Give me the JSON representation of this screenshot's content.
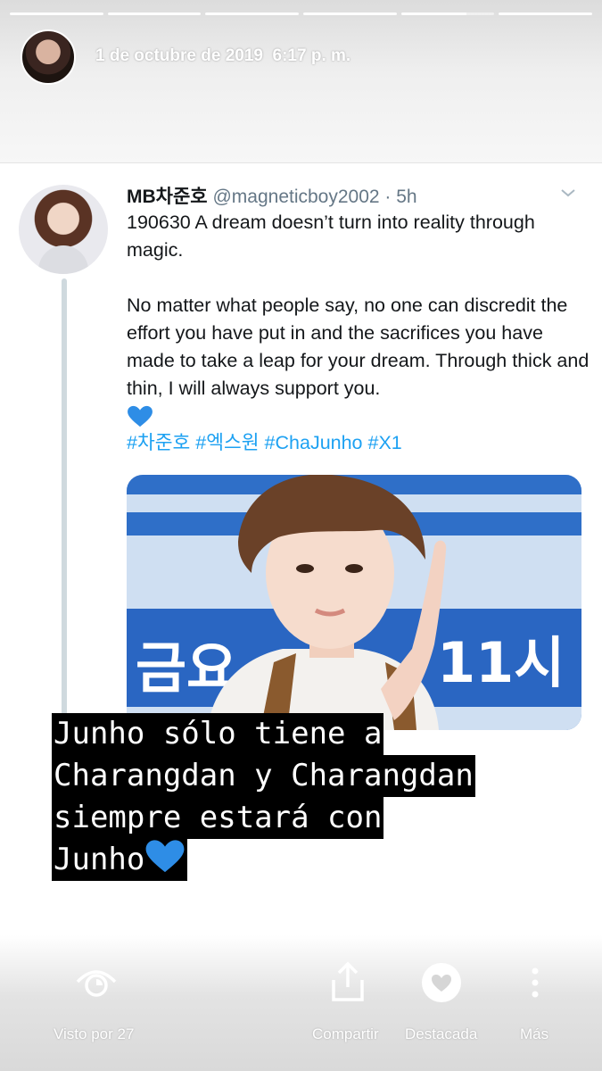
{
  "story": {
    "progress_segments": 6,
    "current_segment": 5,
    "date": "1 de octubre de 2019",
    "time": "6:17 p. m."
  },
  "tweet": {
    "display_name": "MB차준호",
    "handle": "@magneticboy2002",
    "time_ago": "· 5h",
    "paragraph1": "190630 A dream doesn’t turn into reality through magic.",
    "paragraph2": "No matter what people say, no one can discredit the effort you have put in and the sacrifices you have made to take a leap for your dream. Through thick and thin, I will always support you.",
    "hashtags": "#차준호 #엑스원 #ChaJunho #X1",
    "photo_banner_left": "금요",
    "photo_banner_right": "11시"
  },
  "caption": {
    "lines": [
      "Junho sólo tiene a",
      "Charangdan y Charangdan",
      "siempre estará con",
      "Junho"
    ],
    "emoji": "blue-heart-icon"
  },
  "bottom_bar": {
    "viewers_label": "Visto por 27",
    "share_label": "Compartir",
    "highlight_label": "Destacada",
    "more_label": "Más"
  },
  "colors": {
    "hashtag": "#1da1f2",
    "heart": "#2e8de6",
    "caption_bg": "#000000"
  }
}
